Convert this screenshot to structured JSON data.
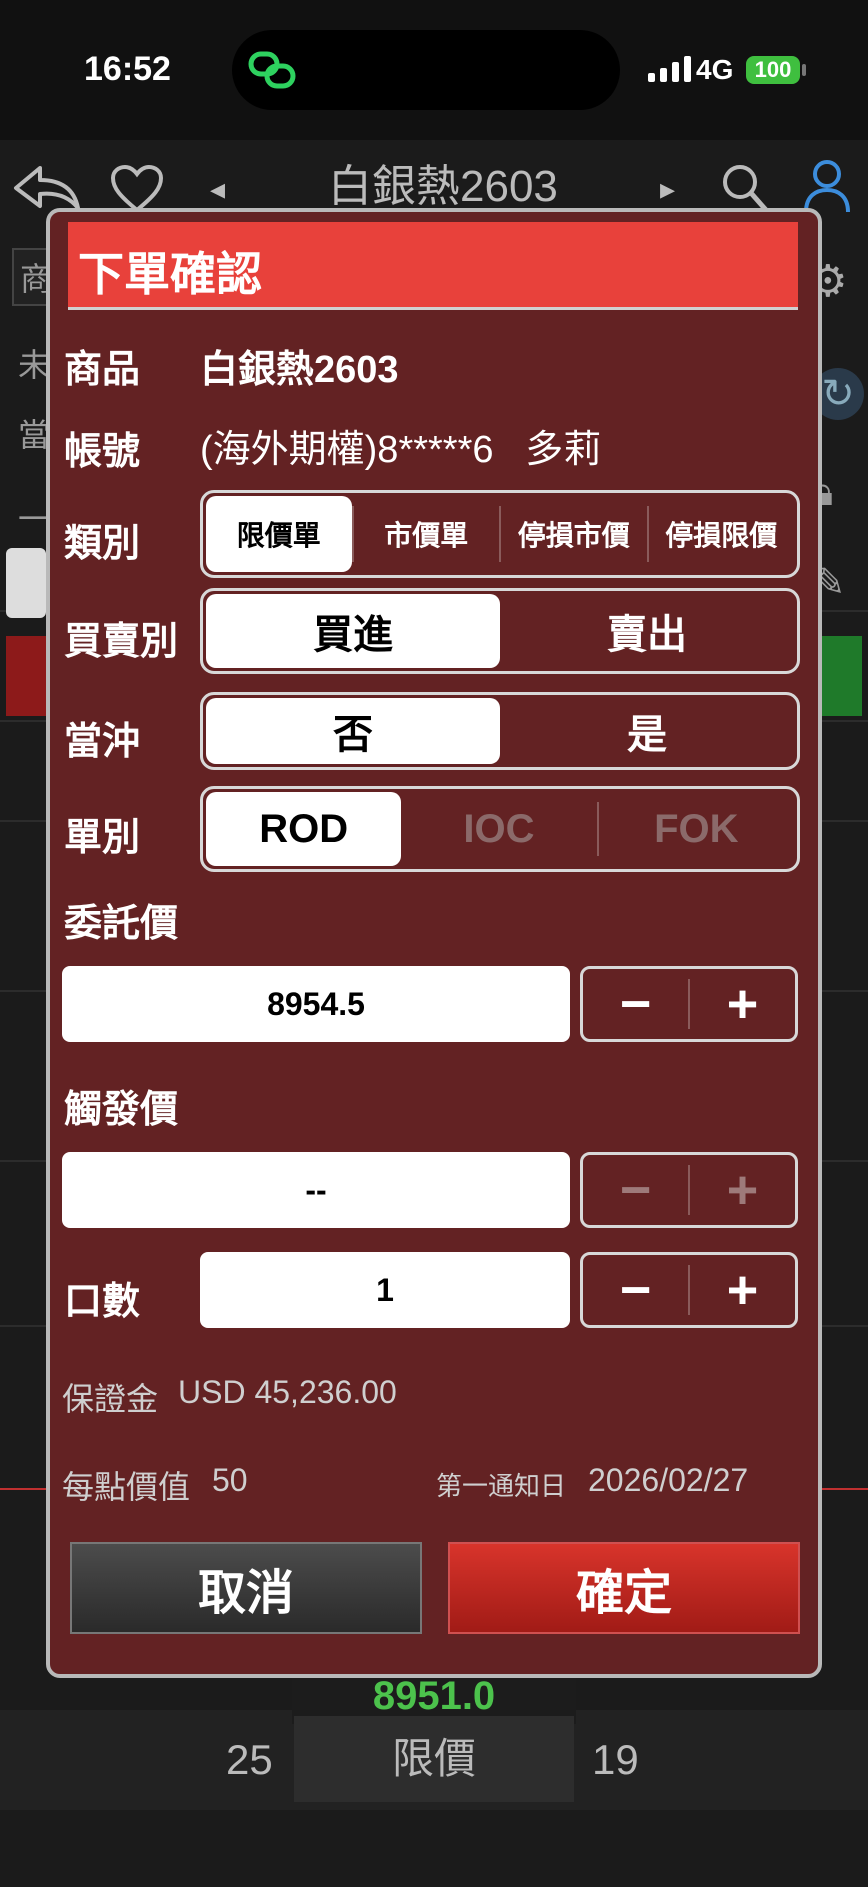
{
  "status_bar": {
    "time": "16:52",
    "network": "4G",
    "battery": "100"
  },
  "nav": {
    "title": "白銀熱2603",
    "prev_arrow": "◂",
    "next_arrow": "▸"
  },
  "background": {
    "side_labels": [
      "商",
      "未",
      "當",
      "一"
    ],
    "last_price": "8951.0",
    "bid_qty": "25",
    "order_type": "限價",
    "ask_qty": "19"
  },
  "modal": {
    "title": "下單確認",
    "product": {
      "label": "商品",
      "value": "白銀熱2603"
    },
    "account": {
      "label": "帳號",
      "value": "(海外期權)8*****6   多莉"
    },
    "order_kind": {
      "label": "類別",
      "options": [
        "限價單",
        "市價單",
        "停損市價",
        "停損限價"
      ],
      "selected": "限價單"
    },
    "side": {
      "label": "買賣別",
      "options": [
        "買進",
        "賣出"
      ],
      "selected": "買進"
    },
    "day_trade": {
      "label": "當沖",
      "options": [
        "否",
        "是"
      ],
      "selected": "否"
    },
    "tif": {
      "label": "單別",
      "options": [
        "ROD",
        "IOC",
        "FOK"
      ],
      "selected": "ROD"
    },
    "price": {
      "label": "委託價",
      "value": "8954.5"
    },
    "trigger": {
      "label": "觸發價",
      "value": "--"
    },
    "qty": {
      "label": "口數",
      "value": "1"
    },
    "stepper": {
      "minus": "−",
      "plus": "+"
    },
    "margin": {
      "label": "保證金",
      "value": "USD 45,236.00"
    },
    "point_value": {
      "label": "每點價值",
      "value": "50"
    },
    "first_notice": {
      "label": "第一通知日",
      "value": "2026/02/27"
    },
    "cancel_label": "取消",
    "confirm_label": "確定"
  },
  "colors": {
    "modal_bg": "#632223",
    "header_red": "#e8413b",
    "confirm_red": "#c42820",
    "price_green": "#4cc24c"
  }
}
